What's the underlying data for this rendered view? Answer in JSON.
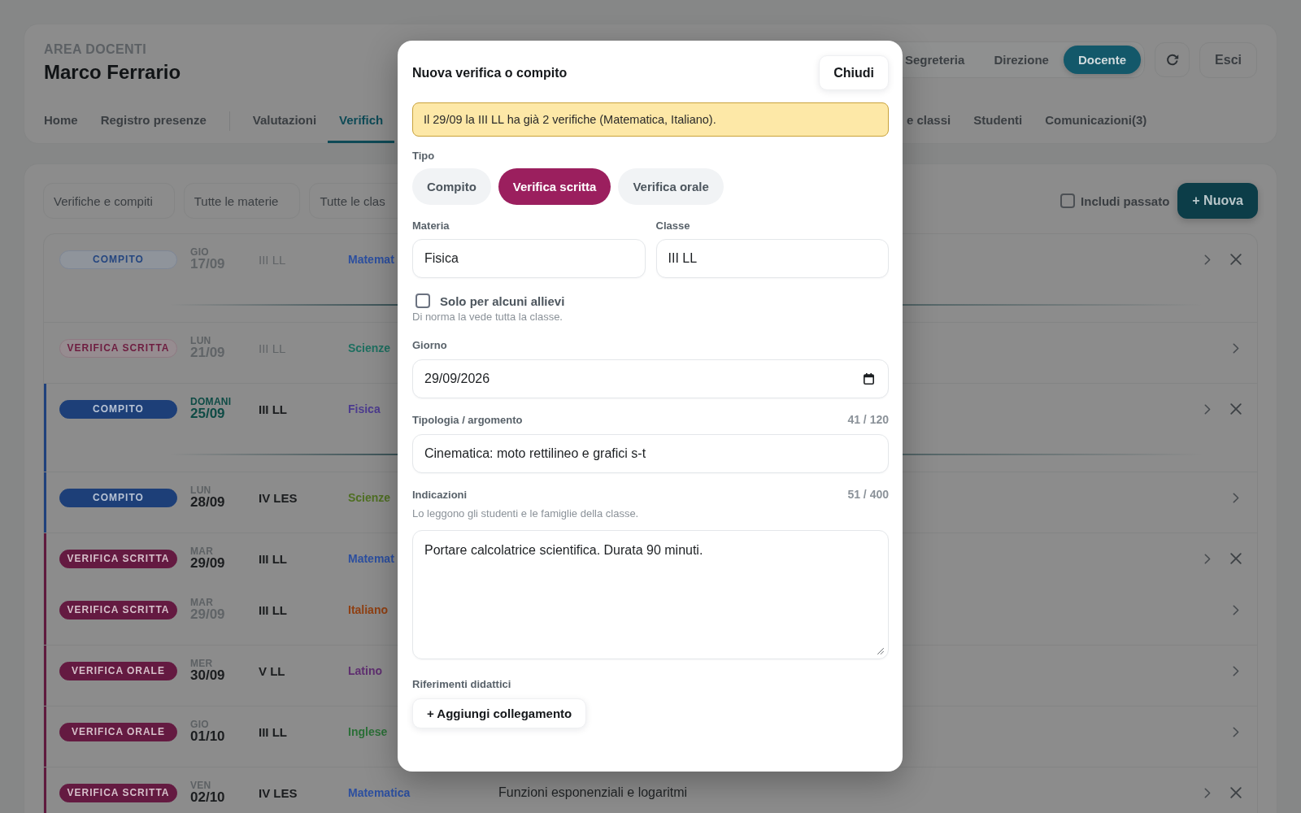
{
  "header": {
    "eyebrow": "AREA DOCENTI",
    "teacher_name": "Marco Ferrario",
    "roles": [
      {
        "label": "Segreteria",
        "selected": false
      },
      {
        "label": "Direzione",
        "selected": false
      },
      {
        "label": "Docente",
        "selected": true
      }
    ],
    "logout_button": "Esci"
  },
  "nav": [
    {
      "items": [
        {
          "label": "Home",
          "selected": false
        },
        {
          "label": "Registro presenze",
          "selected": false
        }
      ]
    },
    {
      "items": [
        {
          "label": "Valutazioni",
          "selected": false
        },
        {
          "label": "Verifich",
          "selected": true
        }
      ]
    },
    {
      "items": [
        {
          "label": "e classi",
          "selected": false
        },
        {
          "label": "Studenti",
          "selected": false
        },
        {
          "label": "Comunicazioni(3)",
          "selected": false
        }
      ]
    }
  ],
  "toolbar": {
    "filters": [
      "Verifiche e compiti",
      "Tutte le materie",
      "Tutte le clas"
    ],
    "include_past": {
      "label": "Includi passato",
      "checked": false
    },
    "new_button": "+ Nuova"
  },
  "rows": [
    {
      "kind": "homework",
      "badge": "COMPITO",
      "weekday": "GIO",
      "date": "17/09",
      "class": "III LL",
      "subject": "Matemat",
      "color": "#2c4f9f",
      "past": true,
      "same_day": false,
      "highlight": false,
      "deletable": true,
      "week_break_after": true
    },
    {
      "kind": "written",
      "badge": "VERIFICA SCRITTA",
      "weekday": "LUN",
      "date": "21/09",
      "class": "III LL",
      "subject": "Scienze",
      "color": "#1e6f60",
      "past": true,
      "same_day": false,
      "highlight": false,
      "deletable": false,
      "week_break_after": false
    },
    {
      "kind": "homework",
      "badge": "COMPITO",
      "weekday": "DOMANI",
      "date": "25/09",
      "class": "III LL",
      "subject": "Fisica",
      "color": "#4c3b8f",
      "past": false,
      "same_day": false,
      "highlight": true,
      "deletable": true,
      "week_break_after": true
    },
    {
      "kind": "homework",
      "badge": "COMPITO",
      "weekday": "LUN",
      "date": "28/09",
      "class": "IV LES",
      "subject": "Scienze",
      "color": "#4f6f23",
      "past": false,
      "same_day": false,
      "highlight": false,
      "deletable": false,
      "week_break_after": false
    },
    {
      "kind": "written",
      "badge": "VERIFICA SCRITTA",
      "weekday": "MAR",
      "date": "29/09",
      "class": "III LL",
      "subject": "Matemat",
      "color": "#2c4f9f",
      "past": false,
      "same_day": false,
      "highlight": false,
      "deletable": true,
      "week_break_after": false
    },
    {
      "kind": "written",
      "badge": "VERIFICA SCRITTA",
      "weekday": "MAR",
      "date": "29/09",
      "class": "III LL",
      "subject": "Italiano",
      "color": "#8f4013",
      "past": false,
      "same_day": true,
      "highlight": false,
      "deletable": false,
      "week_break_after": false
    },
    {
      "kind": "oral",
      "badge": "VERIFICA ORALE",
      "weekday": "MER",
      "date": "30/09",
      "class": "V LL",
      "subject": "Latino",
      "color": "#5f2f70",
      "past": false,
      "same_day": false,
      "highlight": false,
      "deletable": false,
      "week_break_after": false
    },
    {
      "kind": "oral",
      "badge": "VERIFICA ORALE",
      "weekday": "GIO",
      "date": "01/10",
      "class": "III LL",
      "subject": "Inglese",
      "color": "#2b6f37",
      "past": false,
      "same_day": false,
      "highlight": false,
      "deletable": false,
      "week_break_after": false
    },
    {
      "kind": "written",
      "badge": "VERIFICA SCRITTA",
      "weekday": "VEN",
      "date": "02/10",
      "class": "IV LES",
      "subject": "Matematica",
      "color": "#2c4f9f",
      "topic": "Funzioni esponenziali e logaritmi",
      "past": false,
      "same_day": false,
      "highlight": false,
      "deletable": true,
      "week_break_after": false
    }
  ],
  "dialog": {
    "title": "Nuova verifica o compito",
    "close_button": "Chiudi",
    "warning": "Il 29/09 la III LL ha già 2 verifiche (Matematica, Italiano).",
    "type_label": "Tipo",
    "types": [
      {
        "label": "Compito",
        "selected": false
      },
      {
        "label": "Verifica scritta",
        "selected": true
      },
      {
        "label": "Verifica orale",
        "selected": false
      }
    ],
    "subject": {
      "label": "Materia",
      "value": "Fisica"
    },
    "class": {
      "label": "Classe",
      "value": "III LL"
    },
    "restricted": {
      "label": "Solo per alcuni allievi",
      "checked": false,
      "hint": "Di norma la vede tutta la classe."
    },
    "day": {
      "label": "Giorno",
      "value": "29/09/2026"
    },
    "topic": {
      "label": "Tipologia / argomento",
      "counter": "41 / 120",
      "value": "Cinematica: moto rettilineo e grafici s-t"
    },
    "notes": {
      "label": "Indicazioni",
      "counter": "51 / 400",
      "hint": "Lo leggono gli studenti e le famiglie della classe.",
      "value": "Portare calcolatrice scientifica. Durata 90 minuti."
    },
    "references": {
      "label": "Riferimenti didattici",
      "add_button": "+ Aggiungi collegamento"
    }
  }
}
